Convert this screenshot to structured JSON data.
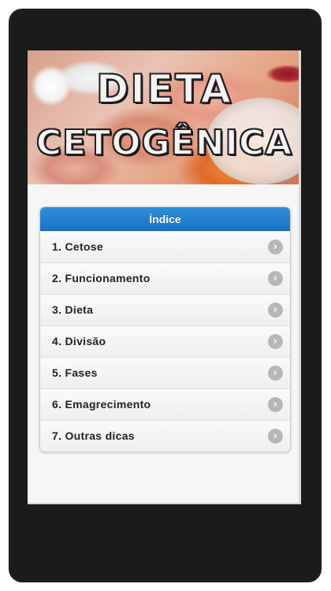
{
  "banner": {
    "title_line1": "DIETA",
    "title_line2": "CETOGÊNICA"
  },
  "index": {
    "header": "Índice",
    "items": [
      {
        "label": "1. Cetose"
      },
      {
        "label": "2. Funcionamento"
      },
      {
        "label": "3. Dieta"
      },
      {
        "label": "4. Divisão"
      },
      {
        "label": "5. Fases"
      },
      {
        "label": "6. Emagrecimento"
      },
      {
        "label": "7. Outras dicas"
      }
    ]
  },
  "icons": {
    "item_arrow": "chevron-right-icon"
  },
  "colors": {
    "header_blue": "#1a73c6",
    "device_frame": "#1b1b1b",
    "arrow_gray": "#b7b7b7"
  }
}
